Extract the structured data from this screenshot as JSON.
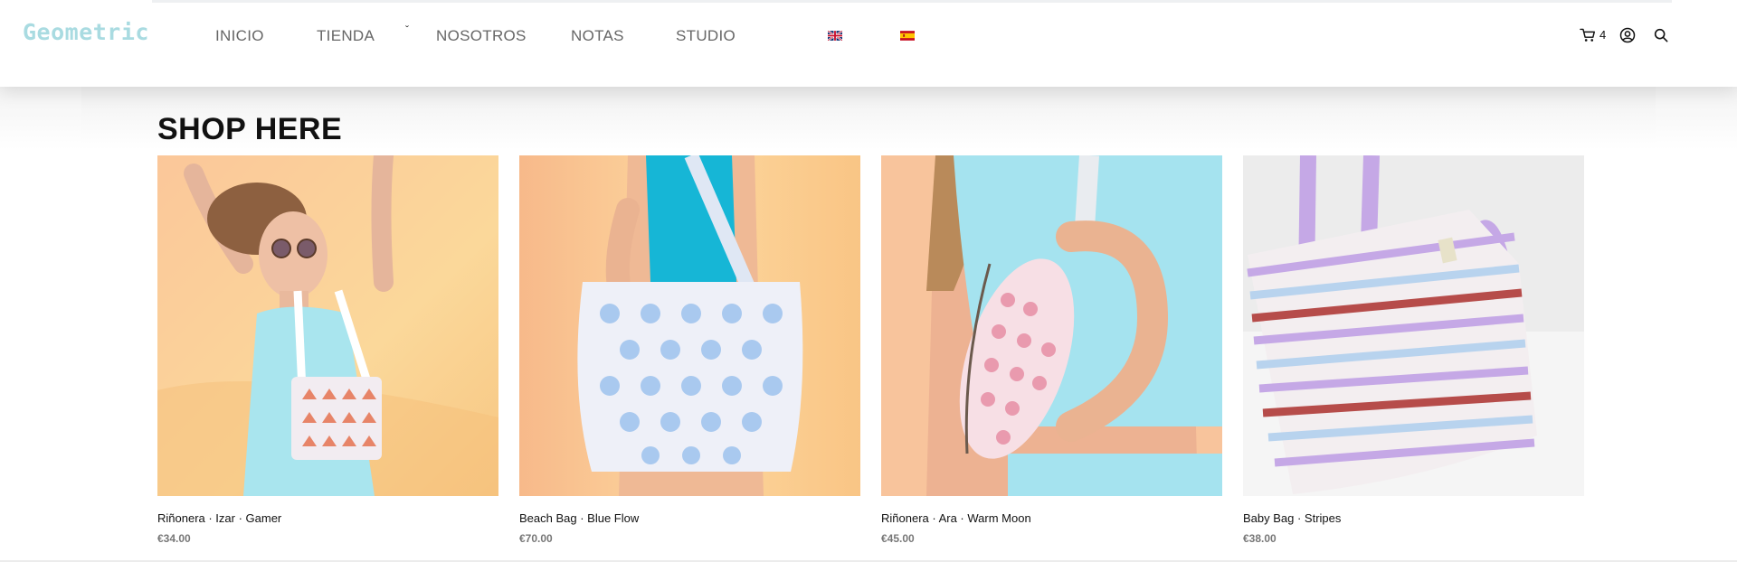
{
  "brand": {
    "logo_text": "Geometric",
    "logo_color": "#a9dbe1"
  },
  "nav": {
    "items": [
      {
        "label": "INICIO"
      },
      {
        "label": "TIENDA"
      },
      {
        "label": "NOSOTROS"
      },
      {
        "label": "NOTAS"
      },
      {
        "label": "STUDIO"
      }
    ],
    "dropdown_indicator": "ˇ",
    "languages": [
      "uk-flag-icon",
      "spain-flag-icon"
    ]
  },
  "header_icons": {
    "cart_count": "4",
    "icons": [
      "cart-icon",
      "account-icon",
      "search-icon"
    ]
  },
  "section": {
    "title": "SHOP HERE"
  },
  "products": [
    {
      "name": "Riñonera · Izar · Gamer",
      "price": "€34.00"
    },
    {
      "name": "Beach Bag · Blue Flow",
      "price": "€70.00"
    },
    {
      "name": "Riñonera · Ara · Warm Moon",
      "price": "€45.00"
    },
    {
      "name": "Baby Bag · Stripes",
      "price": "€38.00"
    }
  ],
  "colors": {
    "accent": "#a9dbe1",
    "nav_text": "#666666",
    "price_text": "#777777",
    "warm_backdrop": "#f9c98e",
    "aqua_top": "#8fdbe9",
    "lilac_stripe": "#c5a8e6"
  }
}
